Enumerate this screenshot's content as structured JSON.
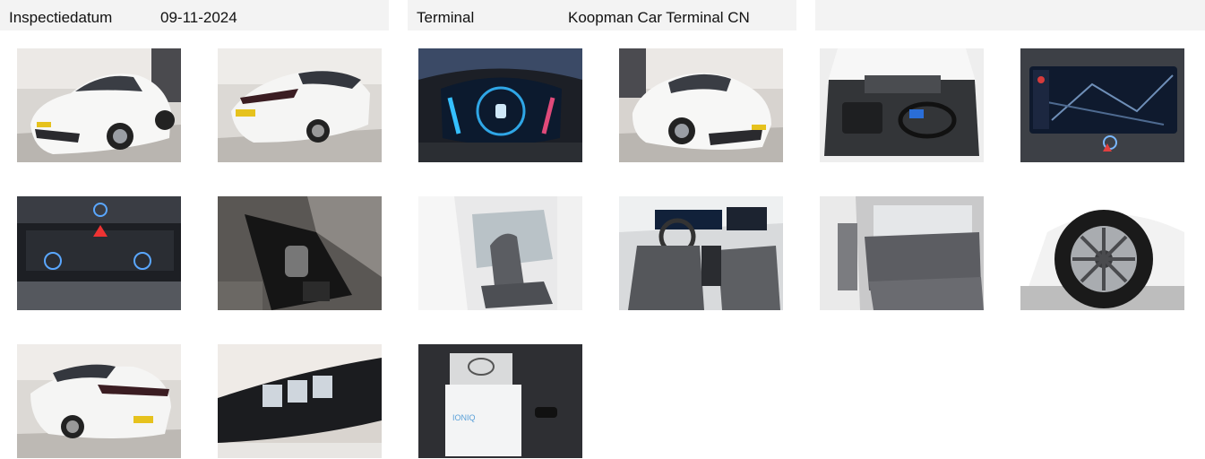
{
  "header": {
    "inspection_label": "Inspectiedatum",
    "inspection_date": "09-11-2024",
    "terminal_label": "Terminal",
    "terminal_value": "Koopman Car Terminal CN"
  },
  "photos": [
    {
      "name": "front-left exterior"
    },
    {
      "name": "rear-left exterior"
    },
    {
      "name": "instrument cluster"
    },
    {
      "name": "front-right exterior"
    },
    {
      "name": "trunk with charging cable"
    },
    {
      "name": "navigation screen"
    },
    {
      "name": "climate controls"
    },
    {
      "name": "gear selector console"
    },
    {
      "name": "driver seat interior"
    },
    {
      "name": "dashboard interior"
    },
    {
      "name": "rear seats"
    },
    {
      "name": "wheel and tyre"
    },
    {
      "name": "rear-right exterior"
    },
    {
      "name": "headlight detail"
    },
    {
      "name": "owner manual and key"
    }
  ]
}
